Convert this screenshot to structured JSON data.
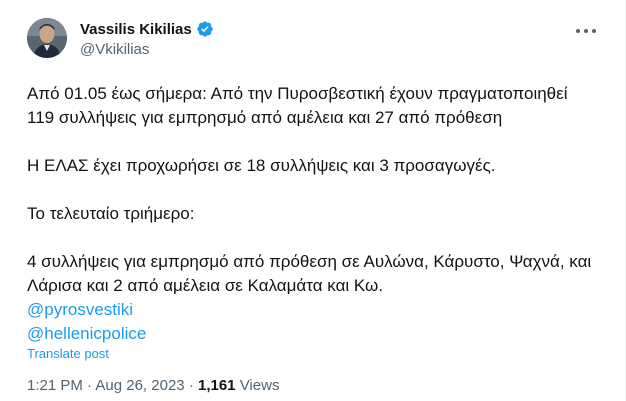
{
  "author": {
    "name": "Vassilis Kikilias",
    "handle": "@Vkikilias"
  },
  "tweet": {
    "line1": "Από 01.05 έως σήμερα: Από την Πυροσβεστική έχουν πραγματοποιηθεί",
    "line2": "119 συλλήψεις για εμπρησμό από αμέλεια και 27 από πρόθεση",
    "line3": "Η ΕΛΑΣ έχει προχωρήσει σε 18 συλλήψεις και 3 προσαγωγές.",
    "line4": "Το τελευταίο τριήμερο:",
    "line5": "4 συλλήψεις για εμπρησμό από πρόθεση σε Αυλώνα, Κάρυστο, Ψαχνά, και",
    "line6": "Λάρισα και 2 από αμέλεια σε Καλαμάτα και Κω.",
    "mentions": [
      "@pyrosvestiki",
      "@hellenicpolice"
    ]
  },
  "translate_label": "Translate post",
  "meta": {
    "time": "1:21 PM",
    "separator": "·",
    "date": "Aug 26, 2023",
    "views_count": "1,161",
    "views_label": "Views"
  },
  "colors": {
    "link": "#1d9bf0",
    "secondary": "#536471",
    "text": "#0f1419"
  },
  "icons": [
    "verified-badge-icon",
    "more-options-icon"
  ]
}
